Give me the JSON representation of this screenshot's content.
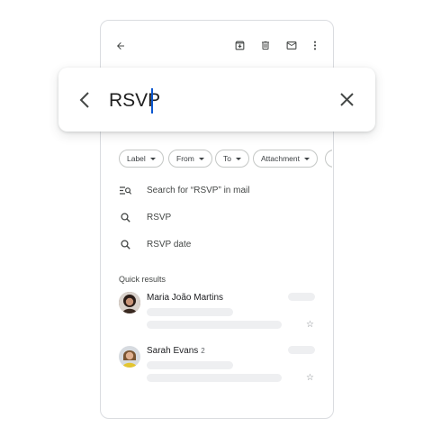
{
  "toolbar": {
    "icons": [
      "back-arrow-icon",
      "archive-icon",
      "trash-icon",
      "mail-icon",
      "more-vert-icon"
    ]
  },
  "search": {
    "query": "RSVP",
    "back_icon": "chevron-left-icon",
    "clear_icon": "close-icon"
  },
  "filters": [
    {
      "label": "Label"
    },
    {
      "label": "From"
    },
    {
      "label": "To"
    },
    {
      "label": "Attachment"
    }
  ],
  "suggestions": [
    {
      "icon": "search-in-mail-icon",
      "label": "Search for “RSVP” in mail"
    },
    {
      "icon": "search-icon",
      "label": "RSVP"
    },
    {
      "icon": "search-icon",
      "label": "RSVP date"
    }
  ],
  "quick_results": {
    "heading": "Quick results",
    "items": [
      {
        "sender": "Maria João Martins",
        "count": ""
      },
      {
        "sender": "Sarah Evans",
        "count": "2"
      }
    ]
  },
  "colors": {
    "accent": "#0b57d0",
    "border": "#dadce0",
    "placeholder": "#eeeff1"
  }
}
